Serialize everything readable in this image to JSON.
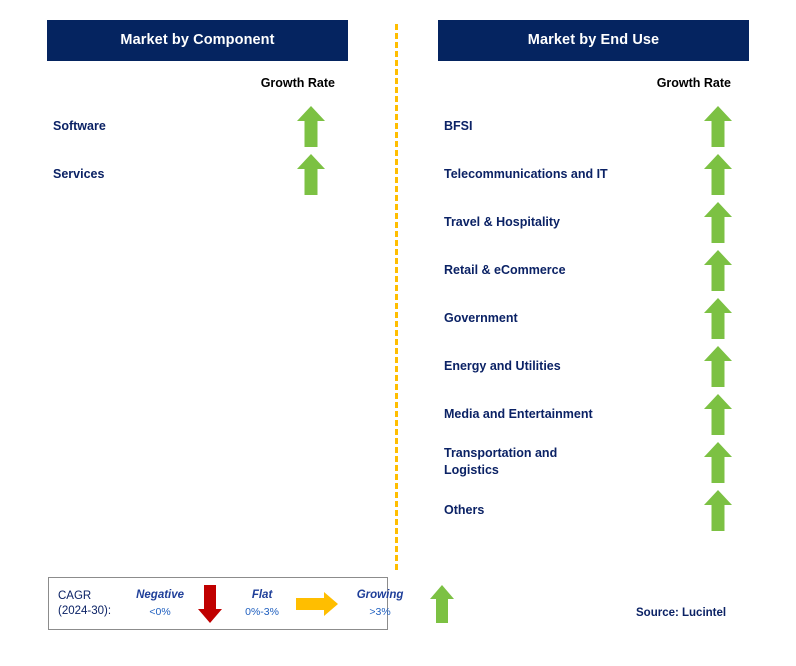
{
  "divider": {
    "color": "#ffbe00",
    "style": "dashed-vertical"
  },
  "columns": [
    {
      "id": "component",
      "title": "Market by Component",
      "banner_color": "#052460",
      "growth_rate_header": "Growth Rate",
      "rows": [
        {
          "label": "Software",
          "growth": "growing",
          "arrow": "arrow-up-green"
        },
        {
          "label": "Services",
          "growth": "growing",
          "arrow": "arrow-up-green"
        }
      ]
    },
    {
      "id": "enduse",
      "title": "Market by End Use",
      "banner_color": "#052460",
      "growth_rate_header": "Growth Rate",
      "rows": [
        {
          "label": "BFSI",
          "growth": "growing",
          "arrow": "arrow-up-green"
        },
        {
          "label": "Telecommunications and IT",
          "growth": "growing",
          "arrow": "arrow-up-green"
        },
        {
          "label": "Travel & Hospitality",
          "growth": "growing",
          "arrow": "arrow-up-green"
        },
        {
          "label": "Retail & eCommerce",
          "growth": "growing",
          "arrow": "arrow-up-green"
        },
        {
          "label": "Government",
          "growth": "growing",
          "arrow": "arrow-up-green"
        },
        {
          "label": "Energy and Utilities",
          "growth": "growing",
          "arrow": "arrow-up-green"
        },
        {
          "label": "Media and Entertainment",
          "growth": "growing",
          "arrow": "arrow-up-green"
        },
        {
          "label": "Transportation and\nLogistics",
          "growth": "growing",
          "arrow": "arrow-up-green"
        },
        {
          "label": "Others",
          "growth": "growing",
          "arrow": "arrow-up-green"
        }
      ]
    }
  ],
  "legend": {
    "cagr_label": "CAGR\n(2024-30):",
    "items": [
      {
        "word": "Negative",
        "range": "<0%",
        "arrow": "arrow-down-red",
        "color": "#c00000"
      },
      {
        "word": "Flat",
        "range": "0%-3%",
        "arrow": "arrow-right-orange",
        "color": "#ffbe00"
      },
      {
        "word": "Growing",
        "range": ">3%",
        "arrow": "arrow-up-green",
        "color": "#7cc143"
      }
    ]
  },
  "source": "Source: Lucintel",
  "chart_data": {
    "type": "table",
    "title": "Market Segmentation Growth Rates",
    "legend_position": "bottom-left",
    "categories": [
      "Software",
      "Services",
      "BFSI",
      "Telecommunications and IT",
      "Travel & Hospitality",
      "Retail & eCommerce",
      "Government",
      "Energy and Utilities",
      "Media and Entertainment",
      "Transportation and Logistics",
      "Others"
    ],
    "series": [
      {
        "name": "Growth Rate (CAGR 2024-30)",
        "values": [
          "growing",
          "growing",
          "growing",
          "growing",
          "growing",
          "growing",
          "growing",
          "growing",
          "growing",
          "growing",
          "growing"
        ]
      }
    ],
    "value_scale": {
      "negative": "<0%",
      "flat": "0%-3%",
      "growing": ">3%"
    },
    "groups": [
      {
        "name": "Market by Component",
        "members": [
          "Software",
          "Services"
        ]
      },
      {
        "name": "Market by End Use",
        "members": [
          "BFSI",
          "Telecommunications and IT",
          "Travel & Hospitality",
          "Retail & eCommerce",
          "Government",
          "Energy and Utilities",
          "Media and Entertainment",
          "Transportation and Logistics",
          "Others"
        ]
      }
    ]
  }
}
